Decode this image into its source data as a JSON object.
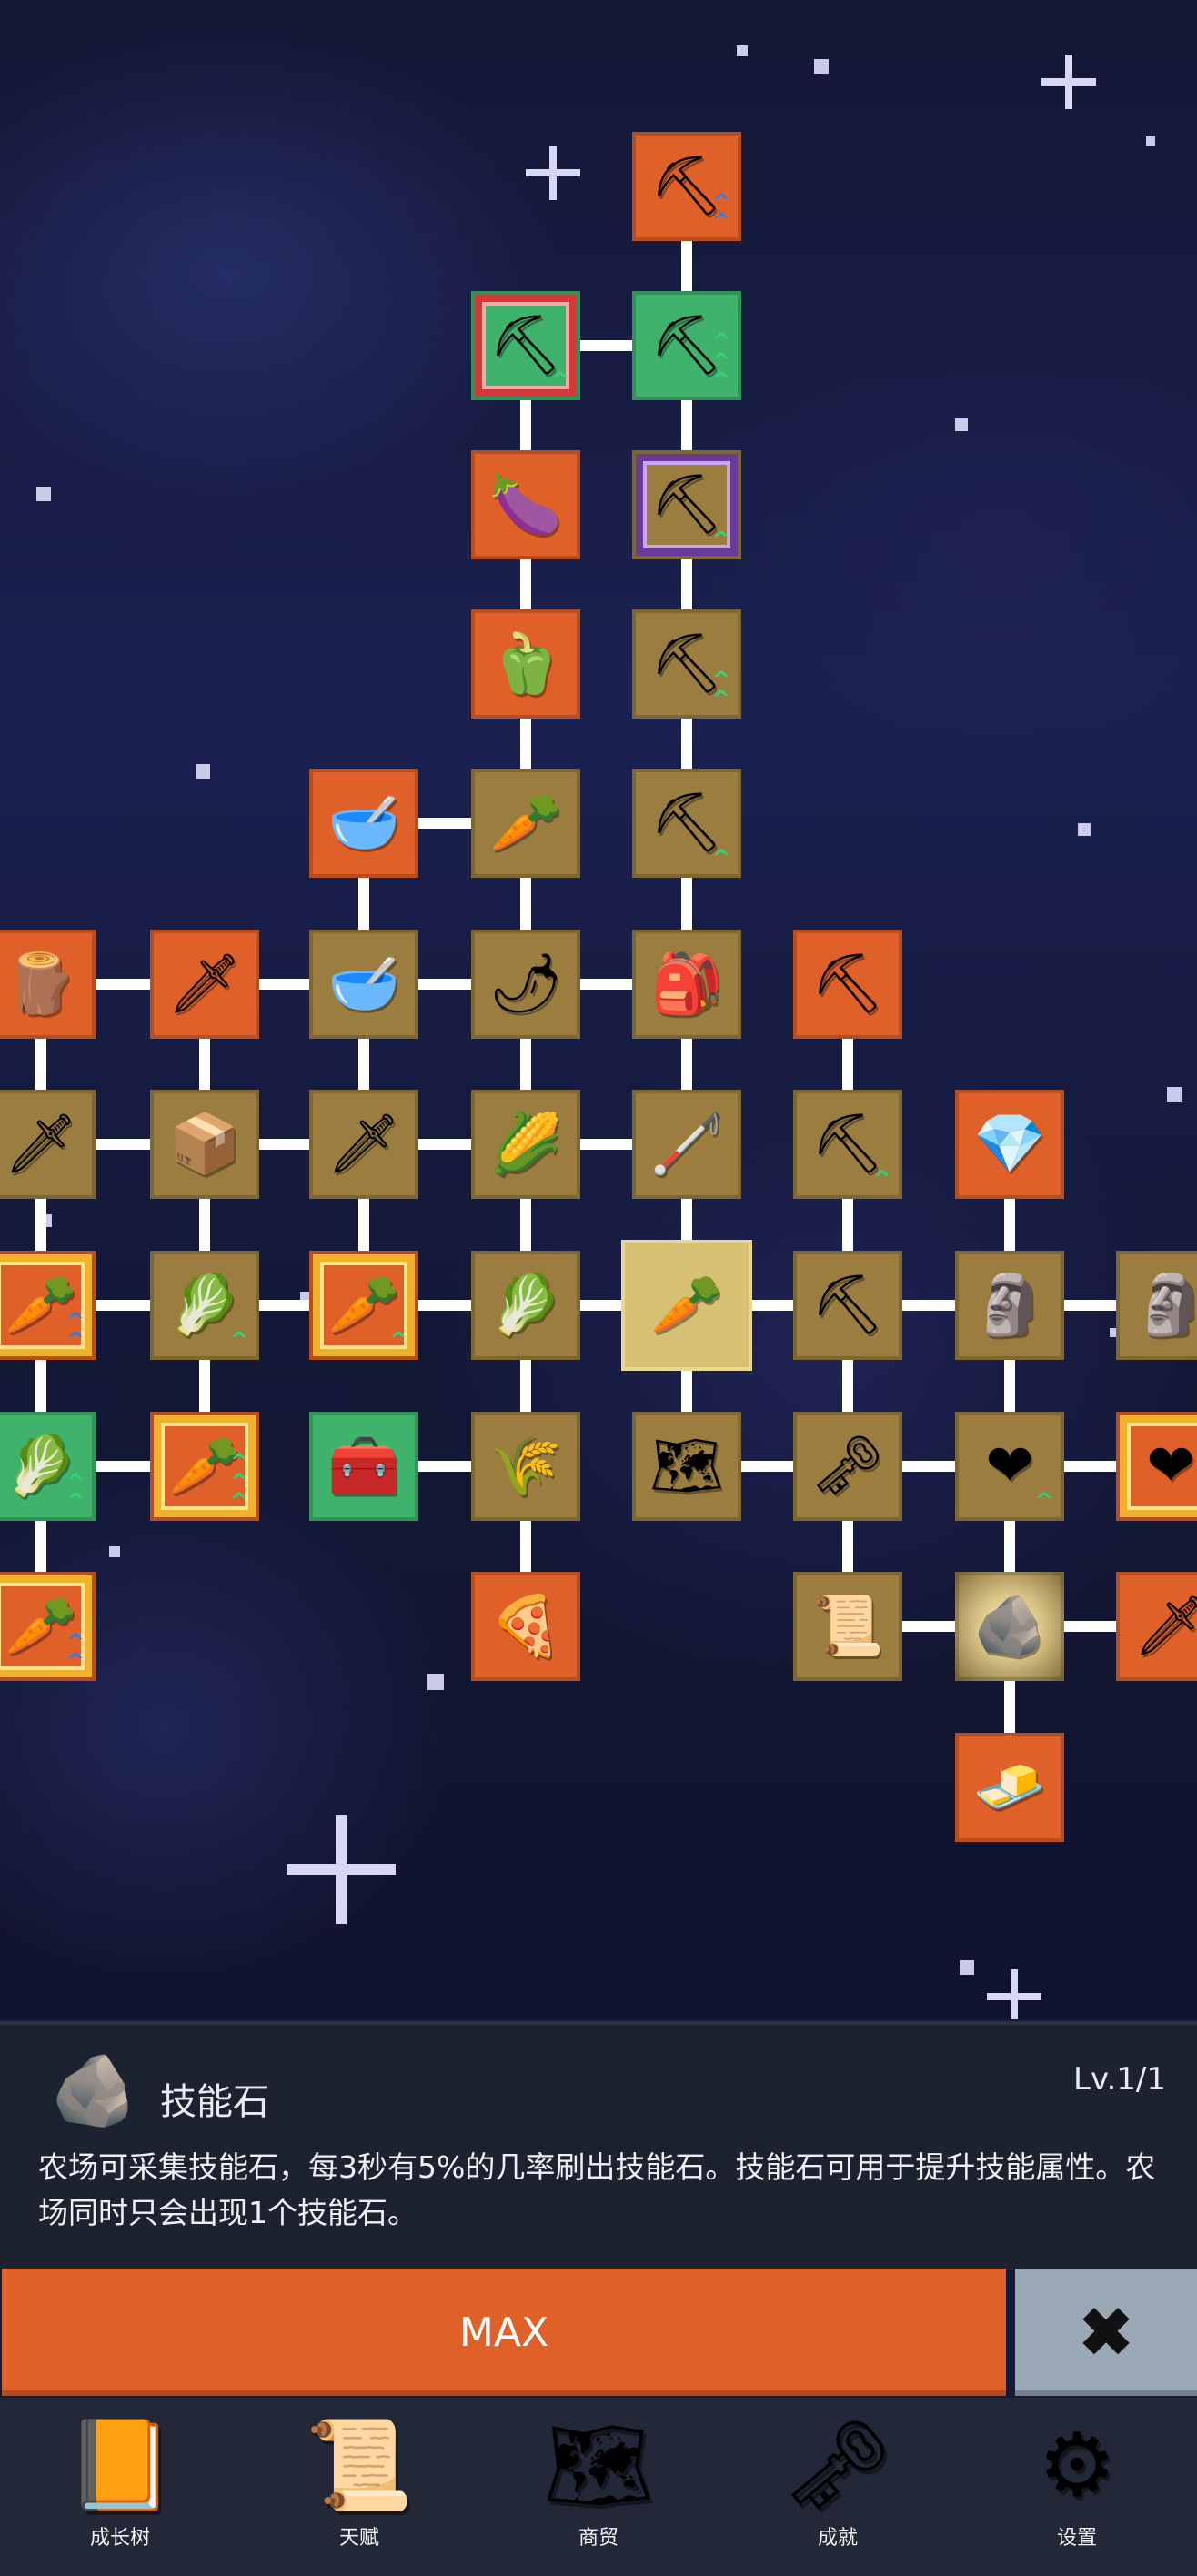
{
  "tree_nodes": [
    {
      "id": "n1",
      "icon": "shovel-icon",
      "glyph": "⛏",
      "color": "orange",
      "upgrade": "blue",
      "arrows": "^^"
    },
    {
      "id": "n2",
      "icon": "shovel-icon",
      "glyph": "⛏",
      "color": "green",
      "upgrade": "green",
      "arrows": "^^^"
    },
    {
      "id": "n3",
      "icon": "shovel-icon",
      "glyph": "⛏",
      "color": "green",
      "frame": "red",
      "upgrade": "green",
      "arrows": "^"
    },
    {
      "id": "n4",
      "icon": "eggplant-icon",
      "glyph": "🍆",
      "color": "orange"
    },
    {
      "id": "n5",
      "icon": "shovel-icon",
      "glyph": "⛏",
      "color": "olive",
      "frame": "purple",
      "upgrade": "green",
      "arrows": "^"
    },
    {
      "id": "n6",
      "icon": "pepper-icon",
      "glyph": "🫑",
      "color": "orange"
    },
    {
      "id": "n7",
      "icon": "shovel-icon",
      "glyph": "⛏",
      "color": "olive",
      "upgrade": "green",
      "arrows": "^^"
    },
    {
      "id": "n8",
      "icon": "bowl-icon",
      "glyph": "🥣",
      "color": "orange"
    },
    {
      "id": "n9",
      "icon": "radish-icon",
      "glyph": "🥕",
      "color": "olive"
    },
    {
      "id": "n10",
      "icon": "shovel-icon",
      "glyph": "⛏",
      "color": "olive",
      "upgrade": "green",
      "arrows": "^"
    },
    {
      "id": "n11",
      "icon": "wood-crate-icon",
      "glyph": "🪵",
      "color": "orange"
    },
    {
      "id": "n12",
      "icon": "sword-icon",
      "glyph": "🗡",
      "color": "orange"
    },
    {
      "id": "n13",
      "icon": "bowl-icon",
      "glyph": "🥣",
      "color": "olive"
    },
    {
      "id": "n14",
      "icon": "chili-icon",
      "glyph": "🌶",
      "color": "olive"
    },
    {
      "id": "n15",
      "icon": "backpack-icon",
      "glyph": "🎒",
      "color": "olive"
    },
    {
      "id": "n16",
      "icon": "pickaxe-icon",
      "glyph": "⛏",
      "color": "orange"
    },
    {
      "id": "n17",
      "icon": "sword-icon",
      "glyph": "🗡",
      "color": "olive"
    },
    {
      "id": "n18",
      "icon": "crate-icon",
      "glyph": "📦",
      "color": "olive"
    },
    {
      "id": "n19",
      "icon": "sword-icon",
      "glyph": "🗡",
      "color": "olive"
    },
    {
      "id": "n20",
      "icon": "corn-icon",
      "glyph": "🌽",
      "color": "olive"
    },
    {
      "id": "n21",
      "icon": "rod-icon",
      "glyph": "🦯",
      "color": "olive"
    },
    {
      "id": "n22",
      "icon": "pickaxe-icon",
      "glyph": "⛏",
      "color": "olive",
      "upgrade": "green",
      "arrows": "^"
    },
    {
      "id": "n23",
      "icon": "crystal-icon",
      "glyph": "💎",
      "color": "orange"
    },
    {
      "id": "n24",
      "icon": "carrot-icon",
      "glyph": "🥕",
      "color": "orange",
      "frame": "yellow",
      "upgrade": "blue",
      "arrows": "^^"
    },
    {
      "id": "n25",
      "icon": "cabbage-icon",
      "glyph": "🥬",
      "color": "olive",
      "upgrade": "green",
      "arrows": "^"
    },
    {
      "id": "n26",
      "icon": "carrot-icon",
      "glyph": "🥕",
      "color": "orange",
      "frame": "yellow",
      "upgrade": "green",
      "arrows": "^"
    },
    {
      "id": "n27",
      "icon": "cabbage-icon",
      "glyph": "🥬",
      "color": "olive"
    },
    {
      "id": "n28",
      "icon": "carrot-icon",
      "glyph": "🥕",
      "color": "selected",
      "selected": true
    },
    {
      "id": "n29",
      "icon": "pickaxe-icon",
      "glyph": "⛏",
      "color": "olive"
    },
    {
      "id": "n30",
      "icon": "statue-icon",
      "glyph": "🗿",
      "color": "olive"
    },
    {
      "id": "n31",
      "icon": "statue-icon",
      "glyph": "🗿",
      "color": "olive"
    },
    {
      "id": "n32",
      "icon": "cabbage-icon",
      "glyph": "🥬",
      "color": "green",
      "upgrade": "green",
      "arrows": "^^"
    },
    {
      "id": "n33",
      "icon": "carrot-icon",
      "glyph": "🥕",
      "color": "orange",
      "frame": "yellow",
      "upgrade": "green",
      "arrows": "^^^"
    },
    {
      "id": "n34",
      "icon": "treasure-chest-icon",
      "glyph": "🧰",
      "color": "green"
    },
    {
      "id": "n35",
      "icon": "parsnip-icon",
      "glyph": "🌾",
      "color": "olive"
    },
    {
      "id": "n36",
      "icon": "map-icon",
      "glyph": "🗺",
      "color": "olive"
    },
    {
      "id": "n37",
      "icon": "key-icon",
      "glyph": "🗝",
      "color": "olive"
    },
    {
      "id": "n38",
      "icon": "heart-icon",
      "glyph": "❤",
      "color": "olive",
      "upgrade": "green",
      "arrows": "^"
    },
    {
      "id": "n39",
      "icon": "heart-icon",
      "glyph": "❤",
      "color": "orange",
      "frame": "yellow"
    },
    {
      "id": "n40",
      "icon": "carrot-icon",
      "glyph": "🥕",
      "color": "orange",
      "frame": "yellow",
      "upgrade": "blue",
      "arrows": "^^"
    },
    {
      "id": "n41",
      "icon": "pizza-icon",
      "glyph": "🍕",
      "color": "orange"
    },
    {
      "id": "n42",
      "icon": "scroll-icon",
      "glyph": "📜",
      "color": "olive"
    },
    {
      "id": "n43",
      "icon": "skill-stone-icon",
      "glyph": "🪨",
      "color": "glow"
    },
    {
      "id": "n44",
      "icon": "sword-icon",
      "glyph": "🗡",
      "color": "orange"
    },
    {
      "id": "n45",
      "icon": "butter-icon",
      "glyph": "🧈",
      "color": "orange"
    }
  ],
  "detail_panel": {
    "icon": "skill-stone-icon",
    "icon_glyph": "🪨",
    "name": "技能石",
    "level": "Lv.1/1",
    "description": "农场可采集技能石，每3秒有5%的几率刷出技能石。技能石可用于提升技能属性。农场同时只会出现1个技能石。"
  },
  "actions": {
    "max_label": "MAX",
    "close_icon": "close-icon",
    "close_glyph": "✖"
  },
  "nav": [
    {
      "id": "growth-tree",
      "label": "成长树",
      "icon": "book-icon",
      "glyph": "📙"
    },
    {
      "id": "talent",
      "label": "天赋",
      "icon": "scroll-icon",
      "glyph": "📜"
    },
    {
      "id": "trade",
      "label": "商贸",
      "icon": "map-icon",
      "glyph": "🗺"
    },
    {
      "id": "achievement",
      "label": "成就",
      "icon": "key-icon",
      "glyph": "🗝"
    },
    {
      "id": "settings",
      "label": "设置",
      "icon": "gear-icon",
      "glyph": "⚙"
    }
  ],
  "colors": {
    "orange": "#df6028",
    "olive": "#9b7e3f",
    "green": "#3fb36b",
    "panel": "#1d2230",
    "navbar": "#232838",
    "close": "#9aa7b5"
  }
}
